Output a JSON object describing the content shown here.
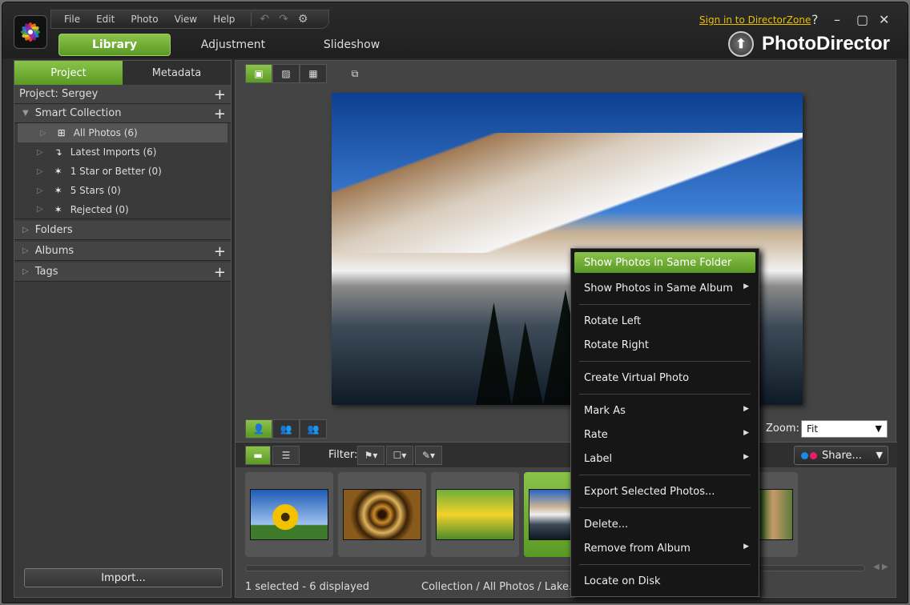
{
  "menu": {
    "file": "File",
    "edit": "Edit",
    "photo": "Photo",
    "view": "View",
    "help": "Help"
  },
  "modes": [
    "Library",
    "Adjustment",
    "Slideshow"
  ],
  "signin": "Sign in to DirectorZone",
  "window_controls": {
    "help": "?",
    "minimize": "–",
    "maximize": "▢",
    "close": "✕"
  },
  "brand": "PhotoDirector",
  "panel_tabs": [
    "Project",
    "Metadata"
  ],
  "project_row": "Project: Sergey",
  "smart_collection": "Smart Collection",
  "collections": [
    {
      "label": "All Photos (6)",
      "icon": "hierarchy-icon"
    },
    {
      "label": "Latest Imports (6)",
      "icon": "import-arrow-icon"
    },
    {
      "label": "1 Star or Better (0)",
      "icon": "sparkle-wand-icon"
    },
    {
      "label": "5 Stars (0)",
      "icon": "sparkle-wand-icon"
    },
    {
      "label": "Rejected (0)",
      "icon": "sparkle-wand-icon"
    }
  ],
  "folders": "Folders",
  "albums": "Albums",
  "tags": "Tags",
  "import_button": "Import...",
  "zoom": {
    "label": "Zoom:",
    "value": "Fit"
  },
  "filter_label": "Filter:",
  "share_button": "Share...",
  "status": "1 selected - 6 displayed",
  "breadcrumb": "Collection / All Photos / Lake.jpg",
  "context_menu": {
    "show_same_folder": "Show Photos in Same Folder",
    "show_same_album": "Show Photos in Same Album",
    "rotate_left": "Rotate Left",
    "rotate_right": "Rotate Right",
    "create_virtual": "Create Virtual Photo",
    "mark_as": "Mark As",
    "rate": "Rate",
    "label": "Label",
    "export_selected": "Export Selected Photos...",
    "delete": "Delete...",
    "remove_album": "Remove from Album",
    "locate_disk": "Locate on Disk"
  },
  "colors": {
    "accent": "#7cb83a",
    "signin": "#e8c100"
  }
}
